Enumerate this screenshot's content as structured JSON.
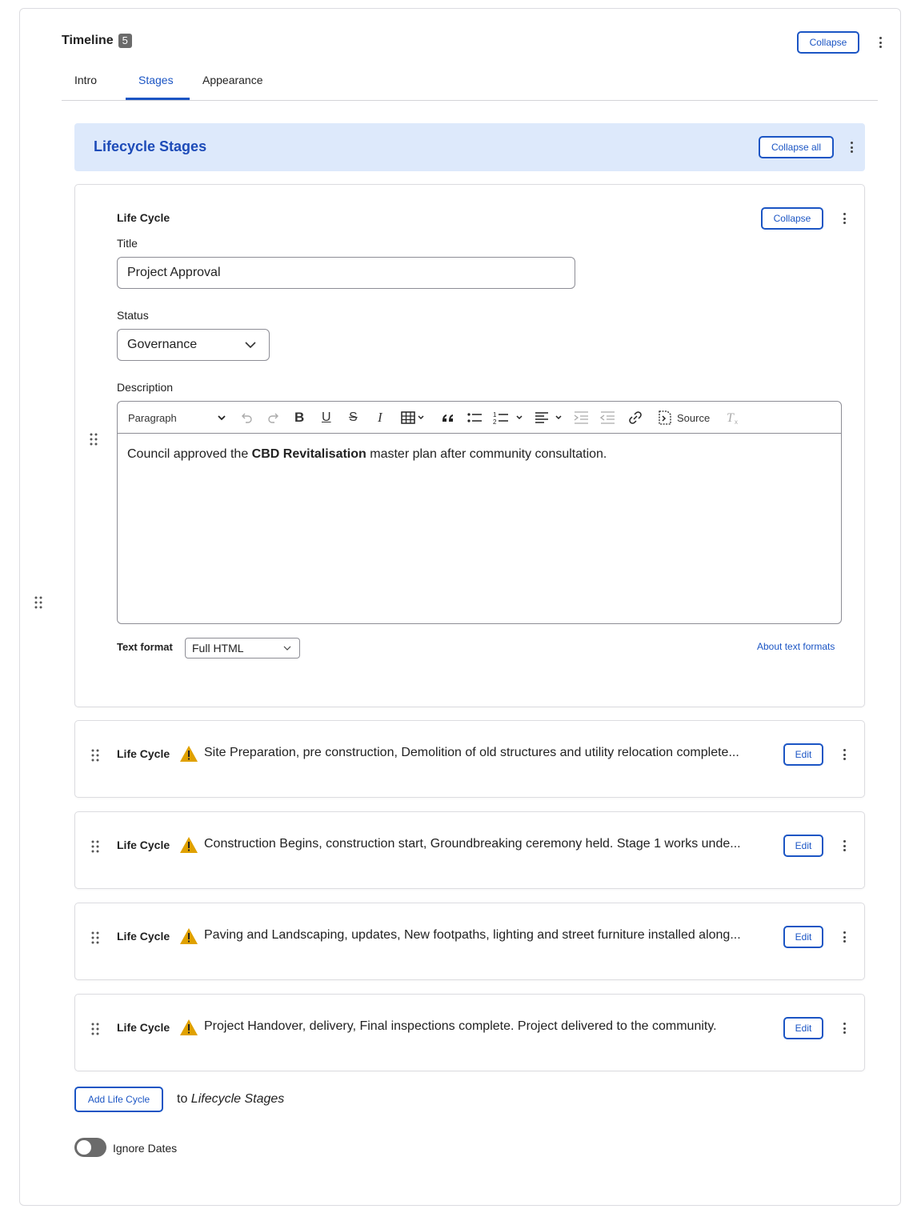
{
  "paragraph": {
    "title": "Timeline",
    "count": "5",
    "collapse_label": "Collapse",
    "tabs": [
      {
        "label": "Intro",
        "active": false
      },
      {
        "label": "Stages",
        "active": true
      },
      {
        "label": "Appearance",
        "active": false
      }
    ]
  },
  "group": {
    "title": "Lifecycle Stages",
    "collapse_all_label": "Collapse all"
  },
  "expanded_item": {
    "type_label": "Life Cycle",
    "collapse_label": "Collapse",
    "title_label": "Title",
    "title_value": "Project Approval",
    "status_label": "Status",
    "status_value": "Governance",
    "description_label": "Description",
    "toolbar": {
      "paragraph_select": "Paragraph",
      "source_label": "Source"
    },
    "body": {
      "before": "Council approved the ",
      "bold": "CBD Revitalisation",
      "after": " master plan after community consultation."
    },
    "text_format_label": "Text format",
    "text_format_value": "Full HTML",
    "about_link": "About text formats"
  },
  "collapsed_items": [
    {
      "type_label": "Life Cycle",
      "summary": "Site Preparation, pre construction, Demolition of old structures and utility relocation complete...",
      "edit_label": "Edit",
      "warning": true
    },
    {
      "type_label": "Life Cycle",
      "summary": "Construction Begins, construction start, Groundbreaking ceremony held. Stage 1 works unde...",
      "edit_label": "Edit",
      "warning": true
    },
    {
      "type_label": "Life Cycle",
      "summary": "Paving and Landscaping, updates, New footpaths, lighting and street furniture installed along...",
      "edit_label": "Edit",
      "warning": true
    },
    {
      "type_label": "Life Cycle",
      "summary": "Project Handover, delivery, Final inspections complete. Project delivered to the community.",
      "edit_label": "Edit",
      "warning": true
    }
  ],
  "add": {
    "button_label": "Add Life Cycle",
    "to_prefix": "to ",
    "to_target": "Lifecycle Stages"
  },
  "ignore_dates": {
    "label": "Ignore Dates",
    "enabled": false
  },
  "colors": {
    "accent": "#1b55c4",
    "group_header_bg": "#dde9fb",
    "warning": "#e0a100"
  }
}
